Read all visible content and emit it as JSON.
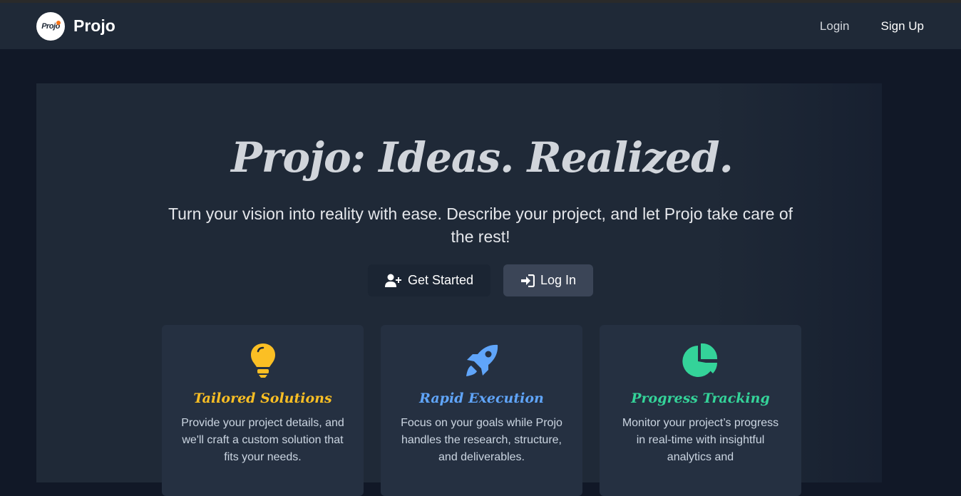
{
  "nav": {
    "logo_text": "Projo",
    "brand": "Projo",
    "login": "Login",
    "signup": "Sign Up"
  },
  "hero": {
    "title": "Projo: Ideas. Realized.",
    "subtitle": "Turn your vision into reality with ease. Describe your project, and let Projo take care of the rest!",
    "get_started": "Get Started",
    "log_in": "Log In"
  },
  "cards": [
    {
      "icon": "lightbulb-icon",
      "title": "Tailored Solutions",
      "color": "#fbbf24",
      "text": "Provide your project details, and we'll craft a custom solution that fits your needs."
    },
    {
      "icon": "rocket-icon",
      "title": "Rapid Execution",
      "color": "#60a5fa",
      "text": "Focus on your goals while Projo handles the research, structure, and deliverables."
    },
    {
      "icon": "pie-chart-icon",
      "title": "Progress Tracking",
      "color": "#34d399",
      "text": "Monitor your project’s progress in real-time with insightful analytics and"
    }
  ],
  "colors": {
    "page_bg": "#111827",
    "navbar_bg": "#1f2937",
    "card_bg": "#253041",
    "secondary_button": "#3b4557"
  }
}
